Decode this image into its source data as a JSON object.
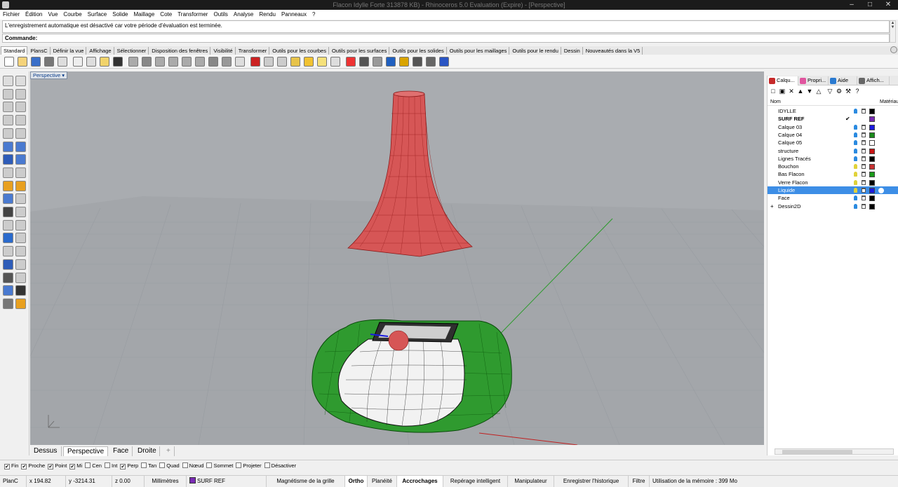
{
  "window": {
    "title": "Flacon Idylle Forte 313878 KB) - Rhinoceros 5.0 Evaluation (Expire) - [Perspective]"
  },
  "menu": [
    "Fichier",
    "Édition",
    "Vue",
    "Courbe",
    "Surface",
    "Solide",
    "Maillage",
    "Cote",
    "Transformer",
    "Outils",
    "Analyse",
    "Rendu",
    "Panneaux",
    "?"
  ],
  "history": {
    "message": "L'enregistrement automatique est désactivé car votre période d'évaluation est terminée."
  },
  "command": {
    "label": "Commande:"
  },
  "toolbar_tabs": [
    "Standard",
    "PlansC",
    "Définir la vue",
    "Affichage",
    "Sélectionner",
    "Disposition des fenêtres",
    "Visibilité",
    "Transformer",
    "Outils pour les courbes",
    "Outils pour les surfaces",
    "Outils pour les solides",
    "Outils pour les maillages",
    "Outils pour le rendu",
    "Dessin",
    "Nouveautés dans la V5"
  ],
  "viewport": {
    "title": "Perspective"
  },
  "view_tabs": [
    "Dessus",
    "Perspective",
    "Face",
    "Droite"
  ],
  "panel": {
    "tabs": [
      "Calqu...",
      "Propri...",
      "Aide",
      "Affich..."
    ],
    "header": {
      "name": "Nom",
      "material": "Matériau"
    },
    "layers": [
      {
        "name": "IDYLLE",
        "color": "#000000",
        "bulb": "#2a8ae0"
      },
      {
        "name": "SURF REF",
        "color": "#7a2bb5",
        "bulb": "",
        "current": true
      },
      {
        "name": "Calque 03",
        "color": "#1a1ae0",
        "bulb": "#2a8ae0"
      },
      {
        "name": "Calque 04",
        "color": "#1a8a1a",
        "bulb": "#2a8ae0"
      },
      {
        "name": "Calque 05",
        "color": "#ffffff",
        "bulb": "#2a8ae0"
      },
      {
        "name": "structure",
        "color": "#c81414",
        "bulb": "#2a8ae0"
      },
      {
        "name": "Lignes Tracés",
        "color": "#000000",
        "bulb": "#2a8ae0"
      },
      {
        "name": "Bouchon",
        "color": "#c83232",
        "bulb": "#e0d23a"
      },
      {
        "name": "Bas Flacon",
        "color": "#1a9a1a",
        "bulb": "#e0d23a"
      },
      {
        "name": "Verre Flacon",
        "color": "#000000",
        "bulb": "#e0d23a"
      },
      {
        "name": "Liquide",
        "color": "#1a1ae0",
        "bulb": "#e0d23a",
        "selected": true
      },
      {
        "name": "Face",
        "color": "#000000",
        "bulb": "#2a8ae0"
      },
      {
        "name": "Dessin2D",
        "color": "#000000",
        "bulb": "#2a8ae0"
      }
    ]
  },
  "osnaps": [
    {
      "label": "Fin",
      "checked": true
    },
    {
      "label": "Proche",
      "checked": true
    },
    {
      "label": "Point",
      "checked": true
    },
    {
      "label": "Mi",
      "checked": true
    },
    {
      "label": "Cen",
      "checked": false
    },
    {
      "label": "Int",
      "checked": false
    },
    {
      "label": "Perp",
      "checked": true
    },
    {
      "label": "Tan",
      "checked": false
    },
    {
      "label": "Quad",
      "checked": false
    },
    {
      "label": "Nœud",
      "checked": false
    },
    {
      "label": "Sommet",
      "checked": false
    },
    {
      "label": "Projeter",
      "checked": false
    },
    {
      "label": "Désactiver",
      "checked": false
    }
  ],
  "status": {
    "cplane": "PlanC",
    "x": "x 194.82",
    "y": "y -3214.31",
    "z": "z 0.00",
    "units": "Millimètres",
    "layer": "SURF REF",
    "layer_color": "#7a2bb5",
    "grid_snap": "Magnétisme de la grille",
    "ortho": "Ortho",
    "planar": "Planéité",
    "osnap": "Accrochages",
    "smarttrack": "Repérage intelligent",
    "gumball": "Manipulateur",
    "history": "Enregistrer l'historique",
    "filter": "Filtre",
    "memory": "Utilisation de la mémoire : 399 Mo"
  }
}
